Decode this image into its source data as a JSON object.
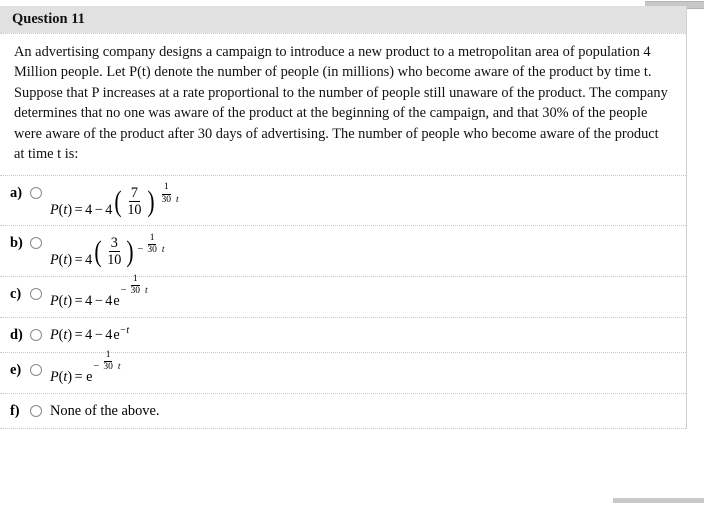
{
  "header": {
    "title": "Question 11"
  },
  "question": {
    "text": "An advertising company designs a campaign to introduce a new product to a metropolitan area of population 4 Million people. Let P(t) denote the number of people (in millions) who become aware of the product by time t. Suppose that P increases at a rate proportional to the number of people still unaware of the product. The company determines that no one was aware of the product at the beginning of the campaign, and that 30% of the people were aware of the product after 30 days of advertising. The number of people who become aware of the product at time t is:"
  },
  "options": [
    {
      "letter": "a)",
      "selected": false,
      "formula_text": "P(t) = 4 - 4 (7/10)^(1/30 t)",
      "parts": {
        "lhs": "P",
        "var": "t",
        "eq": "=",
        "const": "4",
        "minus": "−",
        "coef": "4",
        "frac_num": "7",
        "frac_den": "10",
        "exp_sign": "",
        "exp_num": "1",
        "exp_den": "30",
        "exp_var": "t"
      }
    },
    {
      "letter": "b)",
      "selected": false,
      "formula_text": "P(t) = 4 (3/10)^(-1/30 t)",
      "parts": {
        "lhs": "P",
        "var": "t",
        "eq": "=",
        "coef": "4",
        "frac_num": "3",
        "frac_den": "10",
        "exp_sign": "−",
        "exp_num": "1",
        "exp_den": "30",
        "exp_var": "t"
      }
    },
    {
      "letter": "c)",
      "selected": false,
      "formula_text": "P(t) = 4 - 4 e^(-1/30 t)",
      "parts": {
        "lhs": "P",
        "var": "t",
        "eq": "=",
        "const": "4",
        "minus": "−",
        "coef": "4",
        "base": "e",
        "exp_sign": "−",
        "exp_num": "1",
        "exp_den": "30",
        "exp_var": "t"
      }
    },
    {
      "letter": "d)",
      "selected": false,
      "formula_text": "P(t) = 4 - 4 e^(-t)",
      "parts": {
        "lhs": "P",
        "var": "t",
        "eq": "=",
        "const": "4",
        "minus": "−",
        "coef": "4",
        "base": "e",
        "exp": "−t"
      }
    },
    {
      "letter": "e)",
      "selected": false,
      "formula_text": "P(t) = e^(-1/30 t)",
      "parts": {
        "lhs": "P",
        "var": "t",
        "eq": "=",
        "base": "e",
        "exp_sign": "−",
        "exp_num": "1",
        "exp_den": "30",
        "exp_var": "t"
      }
    },
    {
      "letter": "f)",
      "selected": false,
      "formula_text": "None of the above."
    }
  ],
  "colors": {
    "header_bg": "#e1e1e1",
    "separator": "#c9c9c9",
    "text": "#111111",
    "radio_border": "#8a8a8a",
    "scrollbar": "#c8c8c8"
  }
}
